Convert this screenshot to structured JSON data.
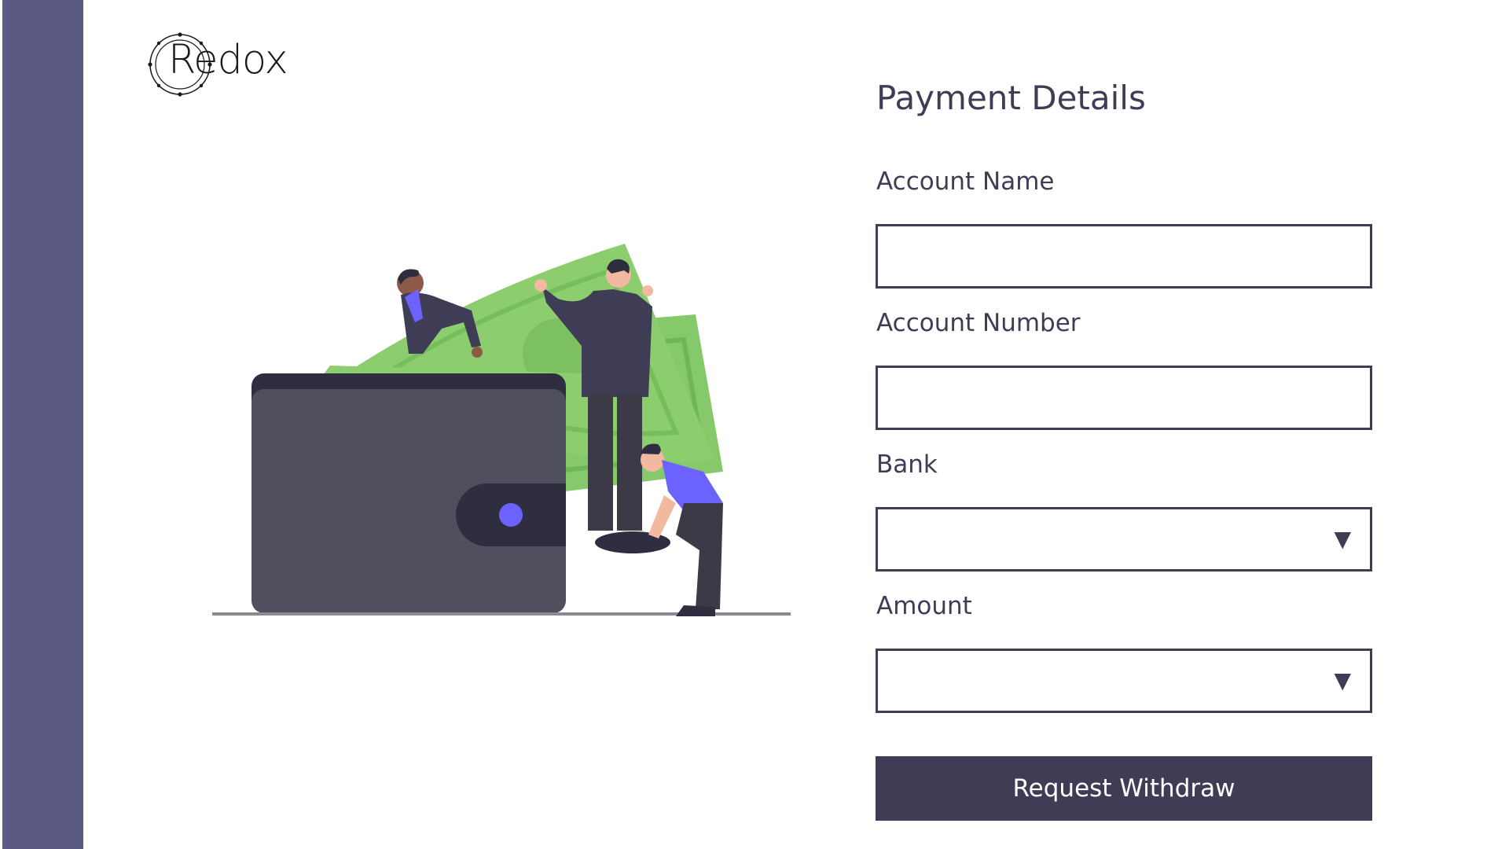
{
  "brand": {
    "name": "Redox"
  },
  "colors": {
    "sidebar": "#5a5a85",
    "primary": "#3f3d56",
    "money_green": "#86c96b",
    "accent_purple": "#6c63ff"
  },
  "form": {
    "title": "Payment Details",
    "account_name": {
      "label": "Account Name",
      "value": ""
    },
    "account_number": {
      "label": "Account Number",
      "value": ""
    },
    "bank": {
      "label": "Bank",
      "value": "",
      "caret": "▼"
    },
    "amount": {
      "label": "Amount",
      "value": "",
      "caret": "▼"
    },
    "submit_label": "Request Withdraw"
  },
  "icons": {
    "logo": "redox-logo-icon",
    "caret": "caret-down-icon",
    "illustration": "wallet-money-illustration"
  }
}
